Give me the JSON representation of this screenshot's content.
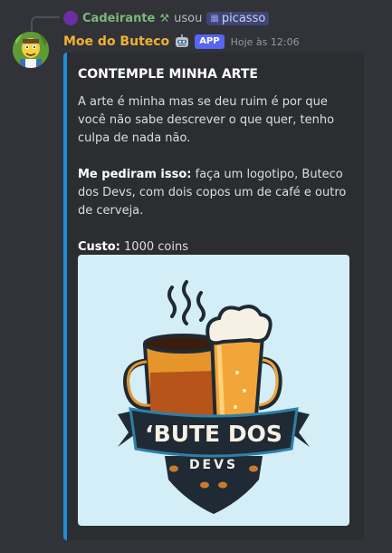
{
  "command": {
    "user_name": "Cadeirante",
    "used_text": "usou",
    "command_name": "picasso"
  },
  "message": {
    "author": "Moe do Buteco",
    "badge": "APP",
    "timestamp": "Hoje às 12:06"
  },
  "embed": {
    "accent_color": "#1e8ed6",
    "title": "CONTEMPLE MINHA ARTE",
    "description": "A arte é minha mas se deu ruim é por que você não sabe descrever o que quer, tenho culpa de nada não.",
    "request_label": "Me pediram isso:",
    "request_text": "faça um logotipo, Buteco dos Devs, com dois copos um de café e outro de cerveja.",
    "cost_label": "Custo:",
    "cost_value": "1000 coins"
  },
  "logo": {
    "main_text": "‘BUTE DOS",
    "sub_text": "DEVS"
  },
  "icons": {
    "command_icon": "slash-command-icon",
    "grid_icon": "grid-icon",
    "bot_icon": "robot-emoji-icon"
  }
}
